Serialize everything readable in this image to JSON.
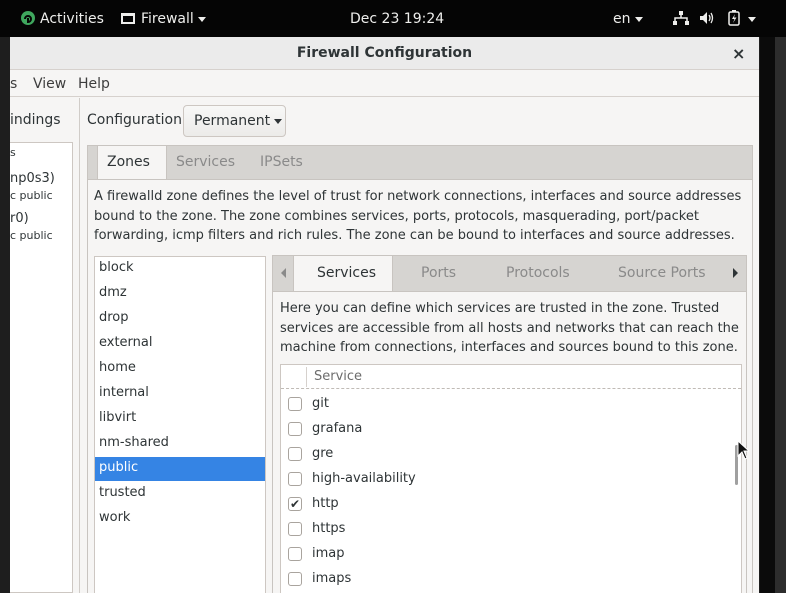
{
  "topbar": {
    "activities": "Activities",
    "app_menu": "Firewall",
    "clock": "Dec 23  19:24",
    "language": "en"
  },
  "window": {
    "title": "Firewall Configuration",
    "close": "×"
  },
  "menubar": {
    "items": [
      "s",
      "View",
      "Help"
    ]
  },
  "left_pane": {
    "tab": "indings",
    "items": [
      {
        "top": "s",
        "sub": ""
      },
      {
        "top": "np0s3)",
        "sub": "c public"
      },
      {
        "top": "r0)",
        "sub": "c public"
      }
    ]
  },
  "configuration": {
    "label": "Configuration:",
    "value": "Permanent"
  },
  "main_tabs": [
    "Zones",
    "Services",
    "IPSets"
  ],
  "zones_description": "A firewalld zone defines the level of trust for network connections, interfaces and source addresses bound to the zone. The zone combines services, ports, protocols, masquerading, port/packet forwarding, icmp filters and rich rules. The zone can be bound to interfaces and source addresses.",
  "zones": [
    "block",
    "dmz",
    "drop",
    "external",
    "home",
    "internal",
    "libvirt",
    "nm-shared",
    "public",
    "trusted",
    "work"
  ],
  "selected_zone": "public",
  "zone_tabs": [
    "Services",
    "Ports",
    "Protocols",
    "Source Ports"
  ],
  "services_description": "Here you can define which services are trusted in the zone. Trusted services are accessible from all hosts and networks that can reach the machine from connections, interfaces and sources bound to this zone.",
  "services_table": {
    "header": "Service",
    "rows": [
      {
        "name": "git",
        "checked": false
      },
      {
        "name": "grafana",
        "checked": false
      },
      {
        "name": "gre",
        "checked": false
      },
      {
        "name": "high-availability",
        "checked": false
      },
      {
        "name": "http",
        "checked": true
      },
      {
        "name": "https",
        "checked": false
      },
      {
        "name": "imap",
        "checked": false
      },
      {
        "name": "imaps",
        "checked": false
      }
    ]
  },
  "colors": {
    "selection": "#3584e4",
    "topbar": "#050505",
    "window_bg": "#f6f5f4"
  }
}
